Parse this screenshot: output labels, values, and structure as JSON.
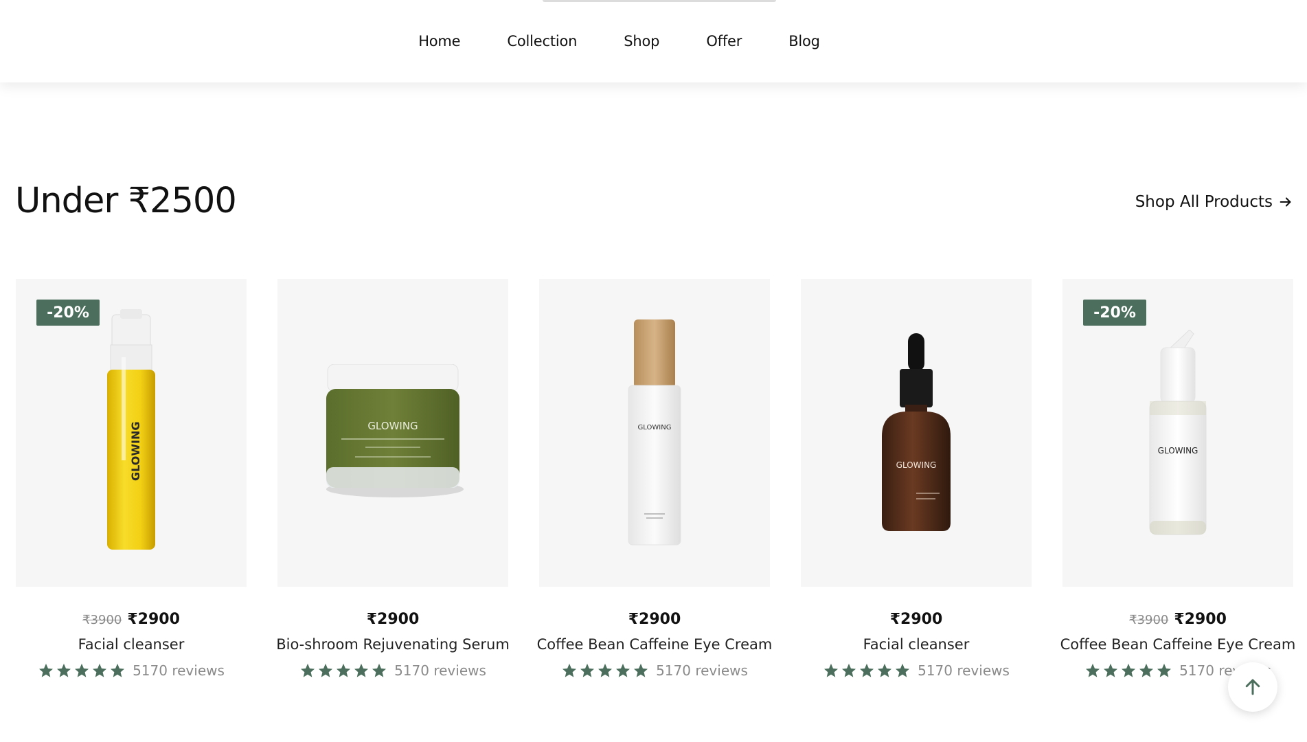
{
  "nav": {
    "items": [
      {
        "label": "Home"
      },
      {
        "label": "Collection"
      },
      {
        "label": "Shop"
      },
      {
        "label": "Offer"
      },
      {
        "label": "Blog"
      }
    ]
  },
  "section": {
    "title": "Under ₹2500",
    "shop_all_label": "Shop All Products"
  },
  "colors": {
    "accent": "#4b6f5c",
    "card_background": "#f6f6f6",
    "muted_text": "#8a8a8a"
  },
  "products": [
    {
      "badge": "-20%",
      "old_price": "₹3900",
      "price": "₹2900",
      "name": "Facial cleanser",
      "rating_stars": 5,
      "reviews": "5170 reviews",
      "image": "yellow-cleanser-bottle",
      "brand_text": "GLOWING"
    },
    {
      "badge": "",
      "old_price": "",
      "price": "₹2900",
      "name": "Bio-shroom Rejuvenating Serum",
      "rating_stars": 5,
      "reviews": "5170 reviews",
      "image": "green-mask-jar",
      "brand_text": "GLOWING"
    },
    {
      "badge": "",
      "old_price": "",
      "price": "₹2900",
      "name": "Coffee Bean Caffeine Eye Cream",
      "rating_stars": 5,
      "reviews": "5170 reviews",
      "image": "frosted-mousse-bottle",
      "brand_text": "GLOWING"
    },
    {
      "badge": "",
      "old_price": "",
      "price": "₹2900",
      "name": "Facial cleanser",
      "rating_stars": 5,
      "reviews": "5170 reviews",
      "image": "amber-dropper-bottle",
      "brand_text": "GLOWING"
    },
    {
      "badge": "-20%",
      "old_price": "₹3900",
      "price": "₹2900",
      "name": "Coffee Bean Caffeine Eye Cream",
      "rating_stars": 5,
      "reviews": "5170 reviews",
      "image": "white-pump-bottle",
      "brand_text": "GLOWING"
    }
  ],
  "scroll_top_icon": "arrow-up-icon"
}
